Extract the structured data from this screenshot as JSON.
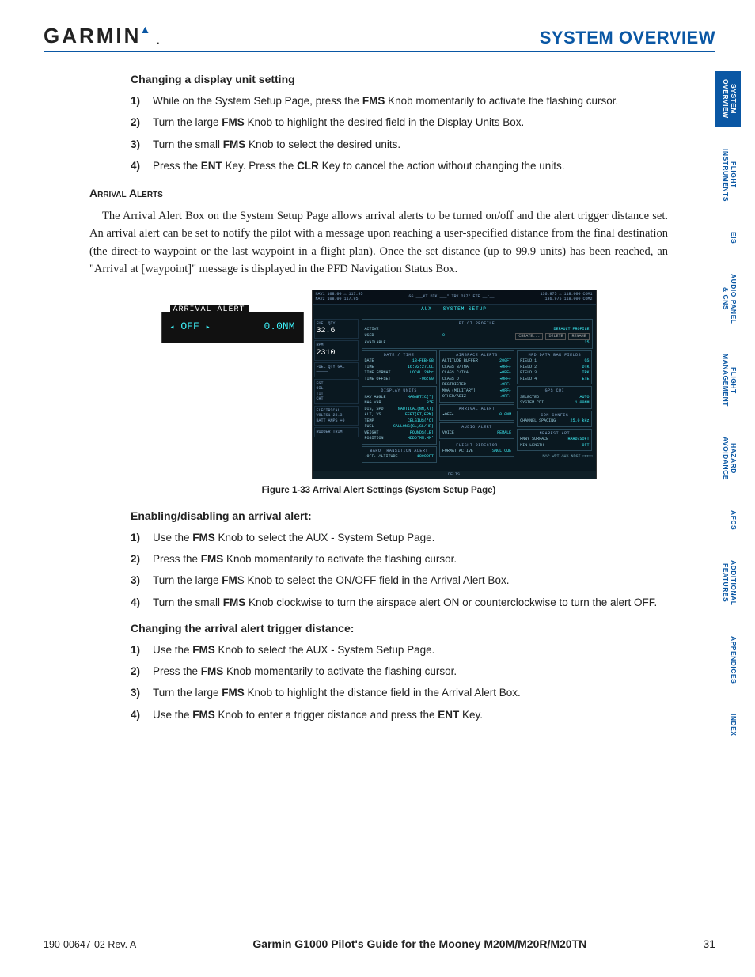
{
  "header": {
    "brand": "GARMIN",
    "section": "SYSTEM OVERVIEW"
  },
  "tabs": [
    "SYSTEM\nOVERVIEW",
    "FLIGHT\nINSTRUMENTS",
    "EIS",
    "AUDIO PANEL\n& CNS",
    "FLIGHT\nMANAGEMENT",
    "HAZARD\nAVOIDANCE",
    "AFCS",
    "ADDITIONAL\nFEATURES",
    "APPENDICES",
    "INDEX"
  ],
  "sec1": {
    "heading": "Changing a display unit setting",
    "steps": [
      {
        "n": "1)",
        "pre": "While on the System Setup Page, press the ",
        "k1": "FMS",
        "post": " Knob momentarily to activate the flashing cursor."
      },
      {
        "n": "2)",
        "pre": "Turn the large ",
        "k1": "FMS",
        "post": " Knob to highlight the desired field in the Display Units Box."
      },
      {
        "n": "3)",
        "pre": "Turn the small ",
        "k1": "FMS",
        "post": " Knob to select the desired units."
      },
      {
        "n": "4)",
        "pre": "Press the ",
        "k1": "ENT",
        "mid": " Key.  Press the ",
        "k2": "CLR",
        "post": " Key to cancel the action without changing the units."
      }
    ]
  },
  "arrival": {
    "heading": "Arrival Alerts",
    "para": "The Arrival Alert Box on the System Setup Page allows arrival alerts to be turned on/off and the alert trigger distance set.  An arrival alert can be set to notify the pilot with a message upon reaching a user-specified distance from the final destination (the direct-to waypoint or the last waypoint in a flight plan).  Once the set distance (up to 99.9 units) has been reached, an \"Arrival at [waypoint]\" message is displayed in the PFD Navigation Status Box."
  },
  "inset": {
    "title": "ARRIVAL ALERT",
    "state": "OFF",
    "dist": "0.0NM"
  },
  "mfd": {
    "top_left1": "NAV1 108.00 ↔ 117.95",
    "top_left2": "NAV2 108.00    117.95",
    "top_mid": "GS ___KT   DTK ___°   TRK 287°   ETE __:__",
    "top_right1": "136.975 ↔ 118.000 COM1",
    "top_right2": "136.975    118.000 COM2",
    "subtitle": "AUX - SYSTEM SETUP",
    "left_fuel": "32.6",
    "left_rpm": "2310",
    "profile": {
      "title": "PILOT PROFILE",
      "active": "DEFAULT PROFILE",
      "used": "0",
      "available": "25",
      "buttons": [
        "CREATE...",
        "DELETE",
        "RENAME"
      ]
    },
    "date": {
      "title": "DATE / TIME",
      "date": "13-FEB-08",
      "time": "16:02:27LCL",
      "fmt": "LOCAL 24hr",
      "offset": "-06:00"
    },
    "airspace": {
      "title": "AIRSPACE ALERTS",
      "buffer": "200FT",
      "classb": "OFF",
      "classc": "OFF",
      "classd": "OFF",
      "restricted": "OFF",
      "moa": "OFF",
      "other": "OFF"
    },
    "mfd_fields": {
      "title": "MFD DATA BAR FIELDS",
      "f1": "GS",
      "f2": "DTK",
      "f3": "TRK",
      "f4": "ETE"
    },
    "display": {
      "title": "DISPLAY UNITS",
      "nav": "MAGNETIC(°)",
      "var": "3°E",
      "dis": "NAUTICAL(NM,KT)",
      "alt": "FEET(FT,FPM)",
      "temp": "CELSIUS(°C)",
      "fuel": "GALLONS(GL,GL/HR)",
      "weight": "POUNDS(LB)",
      "pos": "HDDD°MM.MM'"
    },
    "gps": {
      "title": "GPS CDI",
      "sel": "AUTO",
      "sys": "1.00NM"
    },
    "com": {
      "title": "COM CONFIG",
      "spacing": "25.0 kHz"
    },
    "nearest": {
      "title": "NEAREST APT",
      "surf": "HARD/SOFT",
      "len": "0FT"
    },
    "arr": {
      "title": "ARRIVAL ALERT",
      "state": "OFF",
      "dist": "0.0NM"
    },
    "audio": {
      "title": "AUDIO ALERT",
      "voice": "FEMALE"
    },
    "baro": {
      "title": "BARO TRANSITION ALERT",
      "state": "OFF",
      "alt": "18000FT"
    },
    "flight": {
      "title": "FLIGHT DIRECTOR",
      "fmt": "SNGL CUE"
    },
    "page_group": "MAP  WPT  AUX  NRST  □□□□",
    "softkey": "DFLTS"
  },
  "fig_caption": "Figure 1-33  Arrival Alert Settings (System Setup Page)",
  "sec2": {
    "heading": "Enabling/disabling an arrival alert:",
    "steps": [
      {
        "n": "1)",
        "pre": "Use the ",
        "k1": "FMS",
        "post": " Knob to select the AUX - System Setup Page."
      },
      {
        "n": "2)",
        "pre": "Press the ",
        "k1": "FMS",
        "post": " Knob momentarily to activate the flashing cursor."
      },
      {
        "n": "3)",
        "pre": "Turn the large ",
        "k1": "FM",
        "post": "S Knob to select the ON/OFF field in the Arrival Alert Box."
      },
      {
        "n": "4)",
        "pre": "Turn the small ",
        "k1": "FMS",
        "post": " Knob clockwise to turn the airspace alert ON or counterclockwise to turn the alert OFF."
      }
    ]
  },
  "sec3": {
    "heading": "Changing the arrival alert trigger distance:",
    "steps": [
      {
        "n": "1)",
        "pre": "Use the ",
        "k1": "FMS",
        "post": " Knob to select the AUX - System Setup Page."
      },
      {
        "n": "2)",
        "pre": "Press the ",
        "k1": "FMS",
        "post": " Knob momentarily to activate the flashing cursor."
      },
      {
        "n": "3)",
        "pre": "Turn the large ",
        "k1": "FMS",
        "post": " Knob to highlight the distance field in the Arrival Alert Box."
      },
      {
        "n": "4)",
        "pre": "Use the ",
        "k1": "FMS",
        "mid": " Knob to enter a trigger distance and press the ",
        "k2": "ENT",
        "post": " Key."
      }
    ]
  },
  "footer": {
    "doc": "190-00647-02  Rev. A",
    "title": "Garmin G1000 Pilot's Guide for the Mooney M20M/M20R/M20TN",
    "page": "31"
  }
}
